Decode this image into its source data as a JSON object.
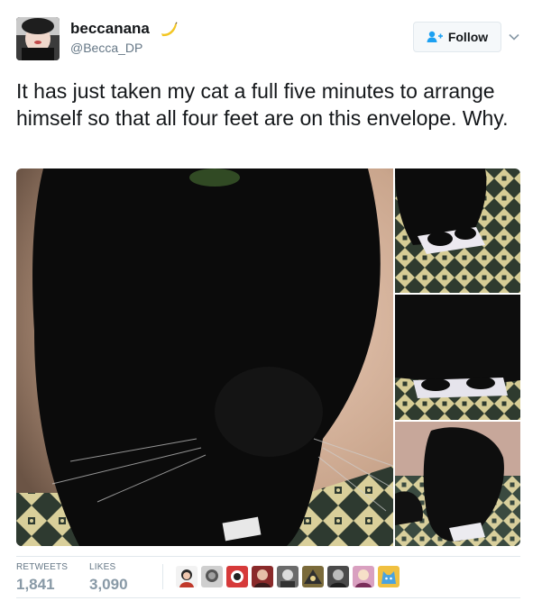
{
  "tweet": {
    "display_name": "beccanana",
    "handle": "@Becca_DP",
    "text": "It has just taken my cat a full five minutes to arrange himself so that all four feet are on this envelope. Why.",
    "name_emoji_icon": "banana-icon"
  },
  "follow_button": {
    "label": "Follow",
    "icon": "add-person-icon"
  },
  "menu": {
    "icon": "chevron-down-icon"
  },
  "media": {
    "photos": [
      "cat-closeup-photo",
      "cat-feet-envelope-photo-1",
      "cat-feet-envelope-photo-2",
      "cat-on-carpet-photo"
    ]
  },
  "stats": {
    "retweets_label": "RETWEETS",
    "retweets_value": "1,841",
    "likes_label": "LIKES",
    "likes_value": "3,090"
  },
  "likers": {
    "count_shown": 9,
    "colors": [
      "#c0392b",
      "#555555",
      "#d63a3a",
      "#8a2a2a",
      "#6b6b6b",
      "#7a6a3a",
      "#4a4a4a",
      "#d9a0c0",
      "#4aa3df"
    ]
  },
  "colors": {
    "text_primary": "#14171a",
    "text_secondary": "#657786",
    "stat_value": "#8899a6",
    "accent": "#1da1f2",
    "border": "#e1e8ed"
  }
}
